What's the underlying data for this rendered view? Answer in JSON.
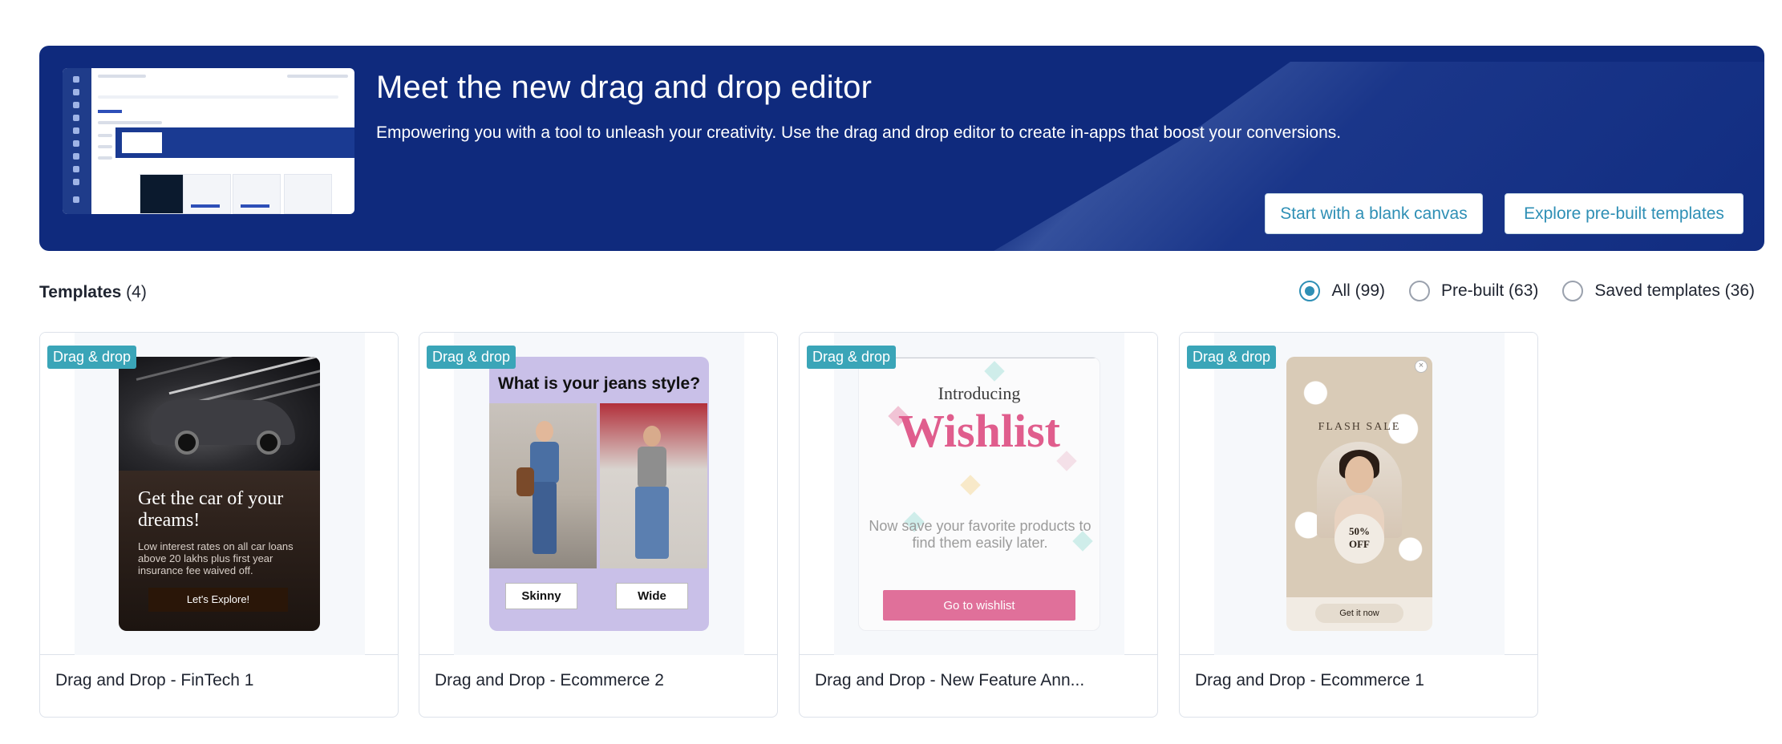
{
  "banner": {
    "title": "Meet the new drag and drop editor",
    "subtitle": "Empowering you with a tool to unleash your creativity. Use the drag and drop editor to create in-apps that boost your conversions.",
    "blank_canvas_label": "Start with a blank canvas",
    "explore_label": "Explore pre-built templates"
  },
  "templates": {
    "heading": "Templates",
    "count": "(4)",
    "filters": [
      {
        "label": "All (99)",
        "selected": true
      },
      {
        "label": "Pre-built (63)",
        "selected": false
      },
      {
        "label": "Saved templates (36)",
        "selected": false
      }
    ]
  },
  "cards": [
    {
      "badge": "Drag & drop",
      "title": "Drag and Drop - FinTech 1",
      "preview": {
        "headline": "Get the car of your dreams!",
        "body": "Low interest rates on all car loans above 20 lakhs plus first year insurance fee waived off.",
        "button": "Let's Explore!"
      }
    },
    {
      "badge": "Drag & drop",
      "title": "Drag and Drop - Ecommerce 2",
      "preview": {
        "question": "What is your jeans style?",
        "option_a": "Skinny",
        "option_b": "Wide"
      }
    },
    {
      "badge": "Drag & drop",
      "title": "Drag and Drop - New Feature Ann...",
      "preview": {
        "intro": "Introducing",
        "feature": "Wishlist",
        "body": "Now save your favorite products to find them easily later.",
        "button": "Go to wishlist"
      }
    },
    {
      "badge": "Drag & drop",
      "title": "Drag and Drop - Ecommerce 1",
      "preview": {
        "title": "FLASH SALE",
        "offer_pct": "50%",
        "offer_word": "OFF",
        "button": "Get it now",
        "close": "×"
      }
    }
  ],
  "colors": {
    "banner_bg": "#0f2a7d",
    "accent": "#2e8fb5",
    "badge": "#3aa5b8"
  }
}
